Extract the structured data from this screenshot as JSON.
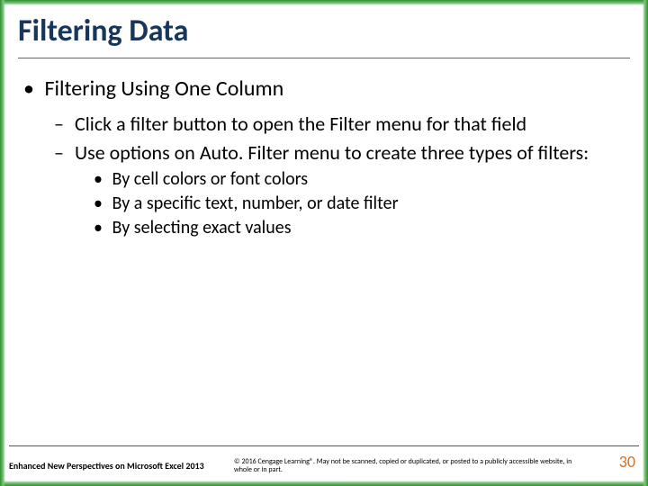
{
  "title": "Filtering Data",
  "bullets": {
    "lvl1": "Filtering Using One Column",
    "lvl2a": "Click a filter button to open the Filter menu for that field",
    "lvl2b": "Use options on Auto. Filter menu to create three types of filters:",
    "lvl3a": "By cell colors or font colors",
    "lvl3b": "By a specific text, number, or date filter",
    "lvl3c": "By selecting exact values"
  },
  "footer": {
    "left": "Enhanced New Perspectives on Microsoft Excel 2013",
    "center": "© 2016 Cengage Learning®. May not be scanned, copied or duplicated, or posted to a publicly accessible website, in whole or in part."
  },
  "page_number": "30"
}
